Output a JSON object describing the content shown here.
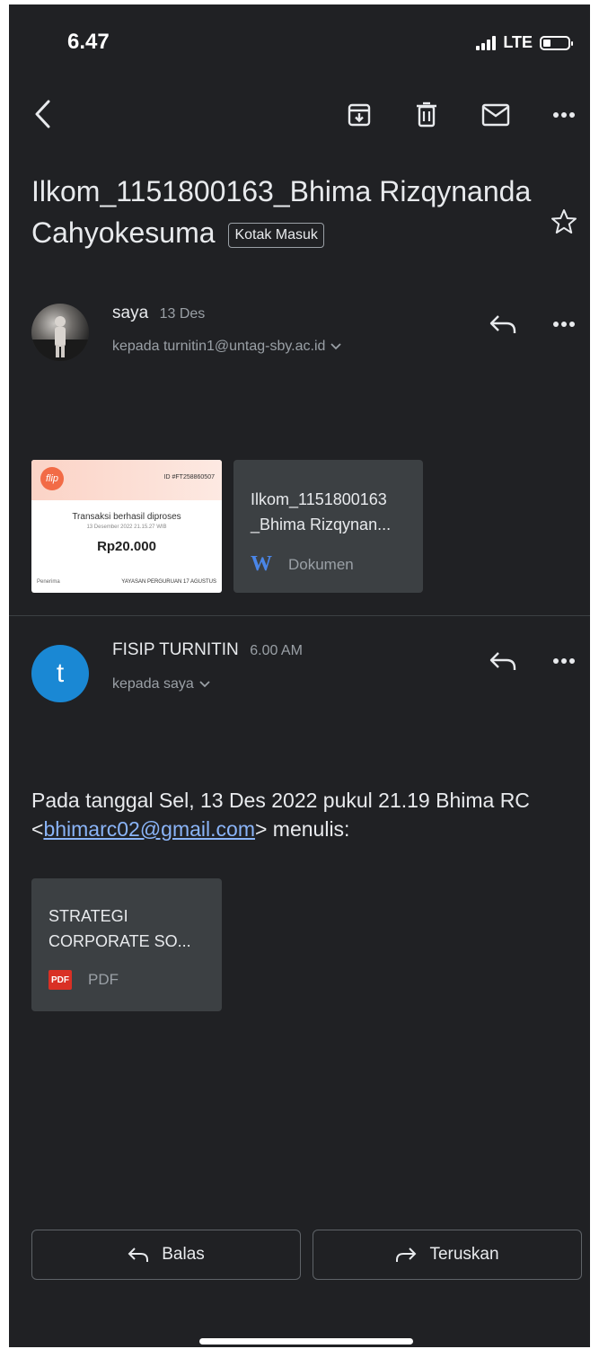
{
  "status_bar": {
    "time": "6.47",
    "network": "LTE"
  },
  "thread": {
    "subject": "Ilkom_1151800163_Bhima Rizqynanda Cahyokesuma",
    "label": "Kotak Masuk"
  },
  "message1": {
    "sender": "saya",
    "date": "13 Des",
    "recipient": "kepada turnitin1@untag-sby.ac.id",
    "image_attachment": {
      "brand": "flip",
      "id": "ID #FT258860507",
      "status": "Transaksi berhasil diproses",
      "datetime": "13 Desember 2022 21.15.27 WIB",
      "amount": "Rp20.000",
      "recipient_label": "Penerima",
      "recipient_value": "YAYASAN PERGURUAN 17 AGUSTUS"
    },
    "doc_attachment": {
      "title": "Ilkom_1151800163 _Bhima Rizqynan...",
      "type": "Dokumen"
    }
  },
  "message2": {
    "sender": "FISIP TURNITIN",
    "date": "6.00 AM",
    "avatar_letter": "t",
    "recipient": "kepada saya",
    "quote_prefix": "Pada tanggal Sel, 13 Des 2022 pukul 21.19 Bhima RC <",
    "quote_email": "bhimarc02@gmail.com",
    "quote_suffix": "> menulis:",
    "pdf_attachment": {
      "title": "STRATEGI CORPORATE SO...",
      "type": "PDF",
      "badge": "PDF"
    }
  },
  "actions": {
    "reply_label": "Balas",
    "forward_label": "Teruskan"
  },
  "colors": {
    "background": "#202124",
    "avatar_t": "#1a88d4",
    "link": "#8ab4f8",
    "card": "#3c4043"
  }
}
